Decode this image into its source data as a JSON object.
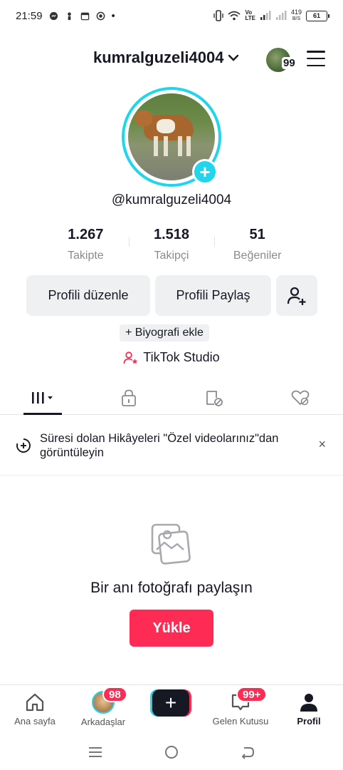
{
  "status_bar": {
    "time": "21:59",
    "dot": "•",
    "net_speed_value": "419",
    "net_speed_unit": "B/S",
    "battery": "61",
    "lte": "LTE",
    "vo": "Vo"
  },
  "header": {
    "username": "kumralguzeli4004",
    "notification_count": "99"
  },
  "profile": {
    "handle": "@kumralguzeli4004"
  },
  "stats": [
    {
      "value": "1.267",
      "label": "Takipte"
    },
    {
      "value": "1.518",
      "label": "Takipçi"
    },
    {
      "value": "51",
      "label": "Beğeniler"
    }
  ],
  "actions": {
    "edit_profile": "Profili düzenle",
    "share_profile": "Profili Paylaş"
  },
  "bio": {
    "add_label": "+ Biyografi ekle"
  },
  "studio": {
    "label": "TikTok Studio"
  },
  "tabs": [
    {
      "icon": "videos-grid-icon",
      "active": true
    },
    {
      "icon": "private-lock-icon",
      "active": false
    },
    {
      "icon": "reposts-icon",
      "active": false
    },
    {
      "icon": "liked-hidden-icon",
      "active": false
    }
  ],
  "notice": {
    "text": "Süresi dolan Hikâyeleri \"Özel videolarınız\"dan görüntüleyin",
    "close": "×"
  },
  "empty_state": {
    "title": "Bir anı fotoğrafı paylaşın",
    "upload": "Yükle"
  },
  "bottom_nav": {
    "home": "Ana sayfa",
    "friends": "Arkadaşlar",
    "friends_badge": "98",
    "inbox": "Gelen Kutusu",
    "inbox_badge": "99+",
    "profile": "Profil",
    "create": "+"
  },
  "colors": {
    "accent_red": "#fe2c55",
    "accent_cyan": "#20d5ec",
    "text_primary": "#161823",
    "text_secondary": "#8a8b91",
    "button_bg": "#eff0f1"
  }
}
